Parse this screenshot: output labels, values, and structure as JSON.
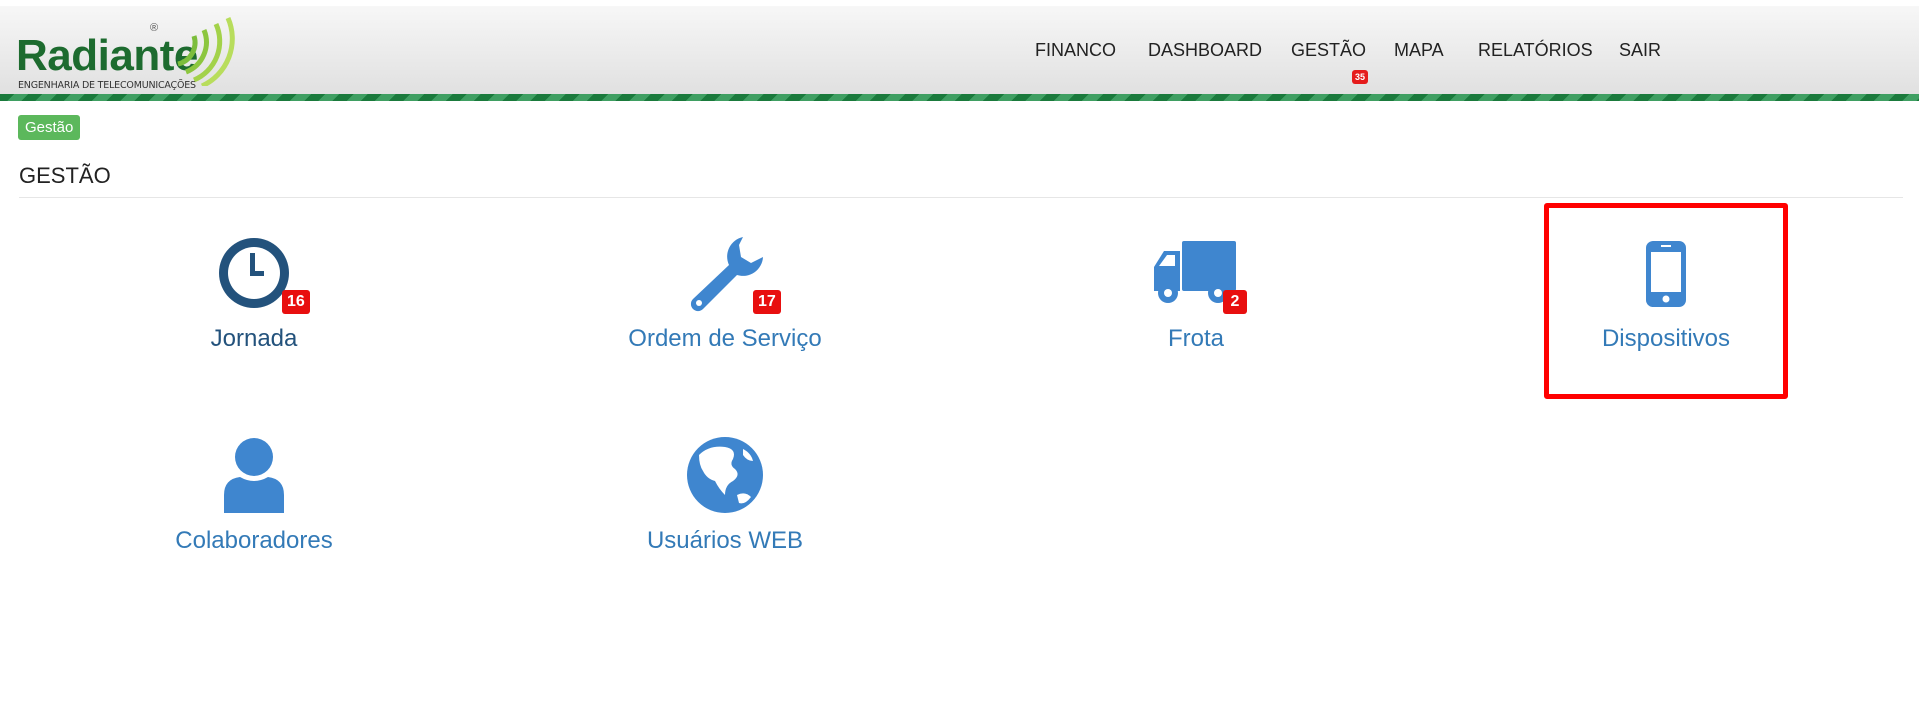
{
  "header": {
    "logo": {
      "name": "Radiante",
      "registered": "®",
      "tagline": "ENGENHARIA DE TELECOMUNICAÇÕES"
    },
    "nav": [
      {
        "label": "FINANCO"
      },
      {
        "label": "DASHBOARD"
      },
      {
        "label": "GESTÃO",
        "badge": "35"
      },
      {
        "label": "MAPA"
      },
      {
        "label": "RELATÓRIOS"
      },
      {
        "label": "SAIR"
      }
    ]
  },
  "breadcrumb": {
    "label": "Gestão"
  },
  "page_title": "GESTÃO",
  "tiles": [
    {
      "label": "Jornada",
      "icon": "clock-icon",
      "badge": "16"
    },
    {
      "label": "Ordem de Serviço",
      "icon": "wrench-icon",
      "badge": "17"
    },
    {
      "label": "Frota",
      "icon": "truck-icon",
      "badge": "2"
    },
    {
      "label": "Dispositivos",
      "icon": "smartphone-icon",
      "highlighted": true
    },
    {
      "label": "Colaboradores",
      "icon": "user-icon"
    },
    {
      "label": "Usuários WEB",
      "icon": "globe-icon"
    }
  ],
  "colors": {
    "brand_green": "#1d6b2f",
    "accent_blue": "#337ab7",
    "icon_blue": "#3f86cf",
    "badge_red": "#e80f0f",
    "highlight_red": "#ff0000",
    "breadcrumb_green": "#5cb85c"
  }
}
